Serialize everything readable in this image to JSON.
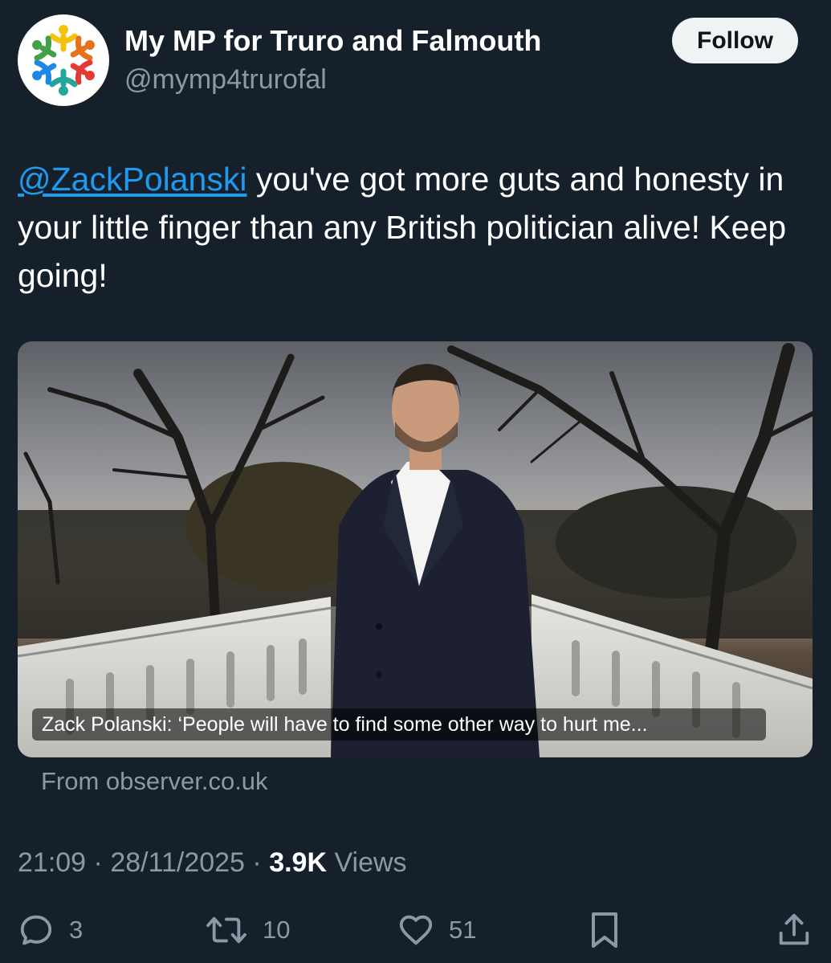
{
  "author": {
    "display_name": "My MP for Truro and Falmouth",
    "handle": "@mymp4trurofal"
  },
  "follow_label": "Follow",
  "tweet": {
    "mention": "@ZackPolanski",
    "text": " you've got more guts and honesty in your little finger than any British politician alive! Keep going!"
  },
  "link_card": {
    "title": "Zack Polanski: ‘People will have to find some other way to hurt me...",
    "source": "From observer.co.uk"
  },
  "meta": {
    "time": "21:09",
    "separator1": " · ",
    "date": "28/11/2025",
    "separator2": " · ",
    "views_count": "3.9K",
    "views_label": " Views"
  },
  "actions": {
    "replies": "3",
    "reposts": "10",
    "likes": "51"
  },
  "icons": {
    "reply": "reply-icon",
    "repost": "repost-icon",
    "like": "heart-icon",
    "bookmark": "bookmark-icon",
    "share": "share-icon"
  },
  "colors": {
    "background": "#15202b",
    "link": "#1d9bf0",
    "secondary_text": "#8b98a5",
    "follow_bg": "#eff3f4"
  }
}
